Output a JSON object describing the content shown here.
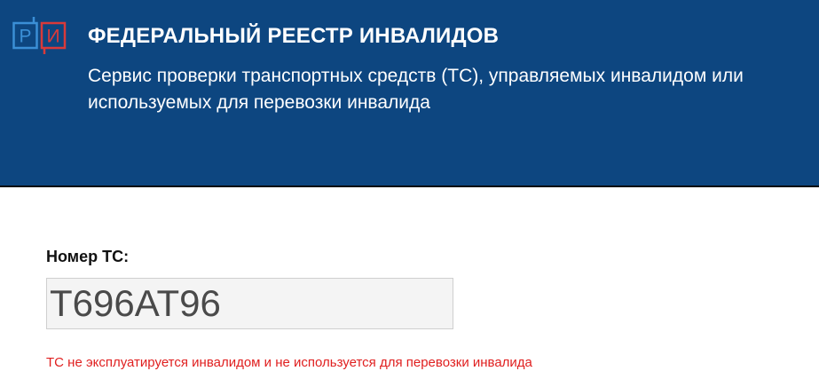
{
  "header": {
    "logo_left_letter": "Р",
    "logo_right_letter": "И",
    "title": "ФЕДЕРАЛЬНЫЙ РЕЕСТР ИНВАЛИДОВ",
    "subtitle": "Сервис проверки транспортных средств (ТС), управляемых инвалидом или используемых для перевозки инвалида"
  },
  "form": {
    "plate_label": "Номер ТС:",
    "plate_value": "Т696АТ96"
  },
  "result": {
    "message": "ТС не эксплуатируется инвалидом и не используется для перевозки инвалида"
  },
  "colors": {
    "header_bg": "#0d4680",
    "logo_blue": "#3b8fd6",
    "logo_red": "#d93a3a",
    "error_text": "#e02020"
  }
}
